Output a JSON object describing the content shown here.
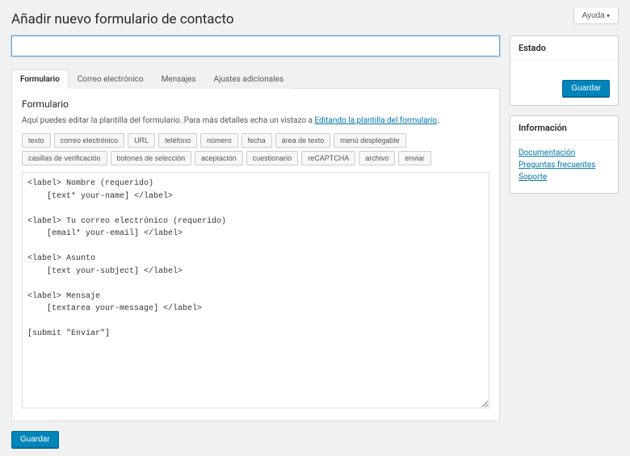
{
  "help_label": "Ayuda",
  "page_title": "Añadir nuevo formulario de contacto",
  "title_input": {
    "value": "",
    "placeholder": ""
  },
  "tabs": [
    {
      "label": "Formulario",
      "active": true
    },
    {
      "label": "Correo electrónico",
      "active": false
    },
    {
      "label": "Mensajes",
      "active": false
    },
    {
      "label": "Ajustes adicionales",
      "active": false
    }
  ],
  "form_panel": {
    "heading": "Formulario",
    "desc_pre": "Aquí puedes editar la plantilla del formulario. Para más detalles echa un vistazo a ",
    "desc_link": "Editando la plantilla del formulario",
    "desc_post": ".",
    "tags": [
      "texto",
      "correo electrónico",
      "URL",
      "teléfono",
      "número",
      "fecha",
      "área de texto",
      "menú desplegable",
      "casillas de verificación",
      "botones de selección",
      "aceptación",
      "cuestionario",
      "reCAPTCHA",
      "archivo",
      "enviar"
    ],
    "template": "<label> Nombre (requerido)\n    [text* your-name] </label>\n\n<label> Tu correo electrónico (requerido)\n    [email* your-email] </label>\n\n<label> Asunto\n    [text your-subject] </label>\n\n<label> Mensaje\n    [textarea your-message] </label>\n\n[submit \"Enviar\"]"
  },
  "sidebar": {
    "status": {
      "title": "Estado",
      "save_label": "Guardar"
    },
    "info": {
      "title": "Información",
      "links": [
        "Documentación",
        "Preguntas frecuentes",
        "Soporte"
      ]
    }
  },
  "bottom_save_label": "Guardar"
}
